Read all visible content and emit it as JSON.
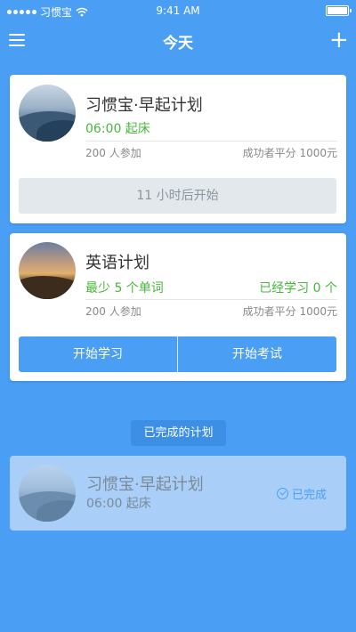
{
  "status_bar": {
    "carrier": "习惯宝",
    "time": "9:41 AM"
  },
  "nav": {
    "title": "今天",
    "add_symbol": "+"
  },
  "plans": [
    {
      "title": "习惯宝·早起计划",
      "subtitle": "06:00 起床",
      "participants": "200 人参加",
      "avg_score": "成功者平分 1000元",
      "countdown": "11 小时后开始"
    },
    {
      "title": "英语计划",
      "subtitle": "最少 5 个单词",
      "progress": "已经学习 0 个",
      "participants": "200 人参加",
      "avg_score": "成功者平分 1000元",
      "start_study_label": "开始学习",
      "start_exam_label": "开始考试"
    }
  ],
  "completed_section": {
    "label": "已完成的计划"
  },
  "completed_plans": [
    {
      "title": "习惯宝·早起计划",
      "subtitle": "06:00 起床",
      "status": "已完成"
    }
  ],
  "colors": {
    "background": "#4a9ff5",
    "accent_green": "#46b83a",
    "button_blue": "#4a9ff5"
  },
  "icons": {
    "menu": "hamburger-icon",
    "add": "plus-icon",
    "done": "check-circle-icon",
    "wifi": "wifi-icon",
    "battery": "battery-icon"
  }
}
